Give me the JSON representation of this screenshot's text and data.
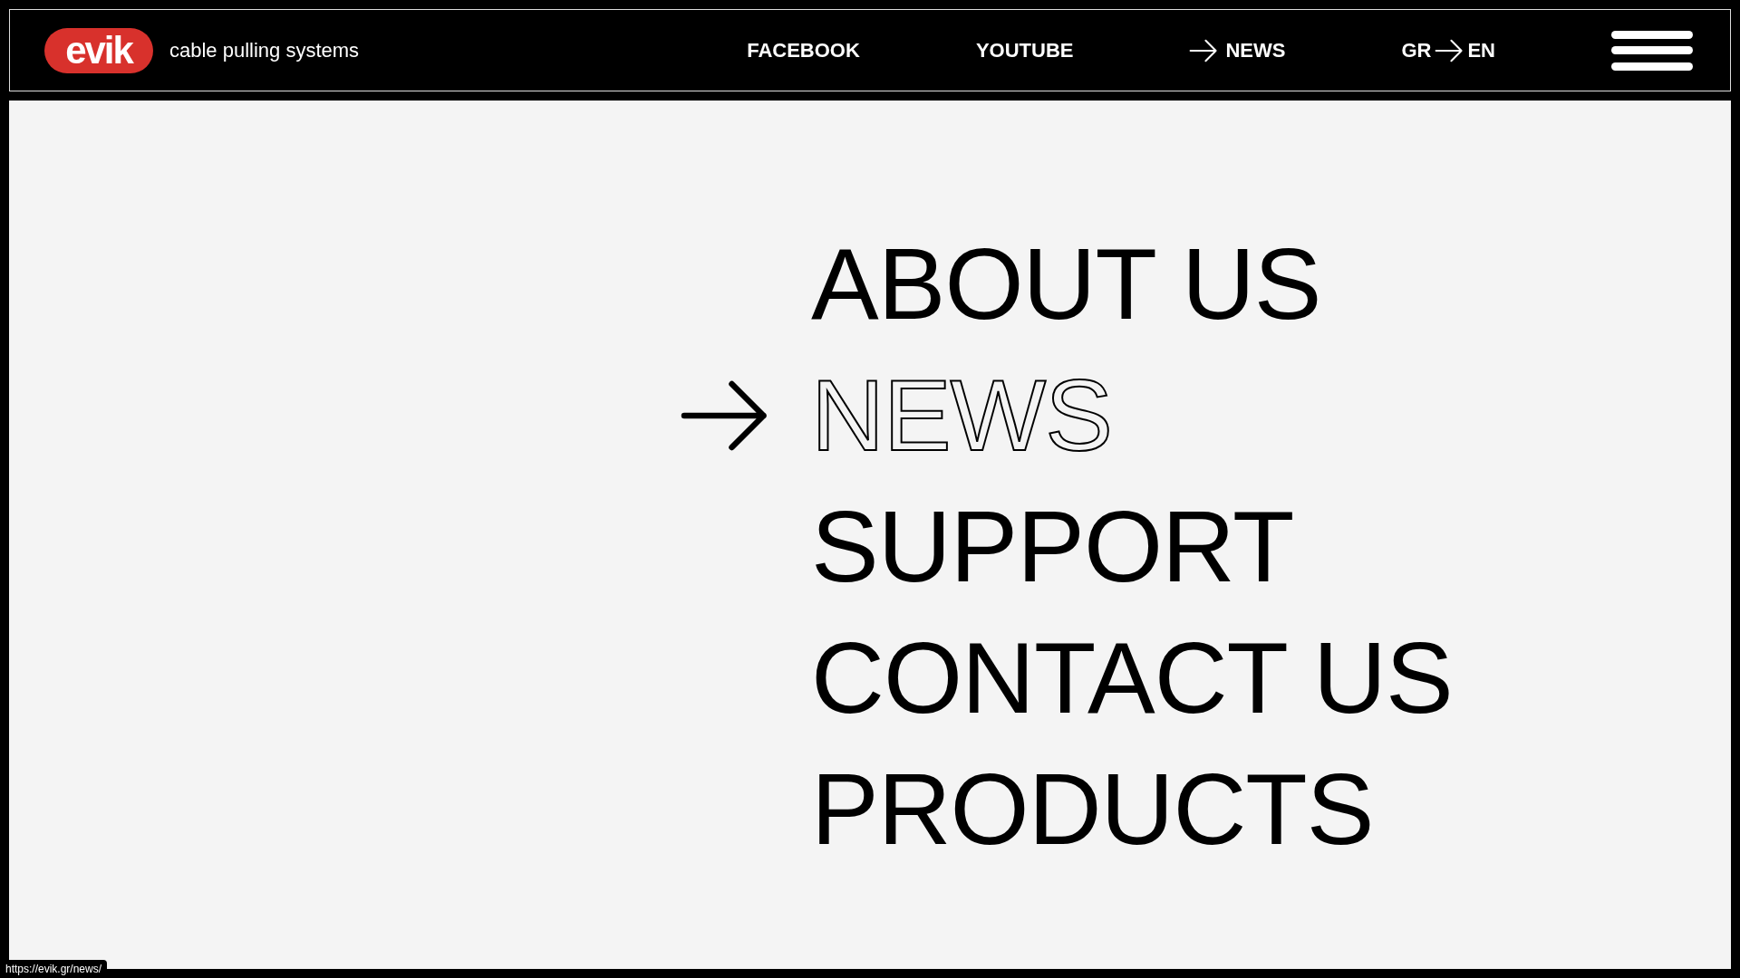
{
  "header": {
    "logo": {
      "text": "evik"
    },
    "tagline": "cable pulling systems",
    "links": [
      {
        "label": "FACEBOOK",
        "selected": false
      },
      {
        "label": "YOUTUBE",
        "selected": false
      },
      {
        "label": "NEWS",
        "selected": true
      }
    ],
    "language": {
      "from": "GR",
      "to": "EN"
    }
  },
  "menu": {
    "items": [
      {
        "label": "ABOUT US",
        "selected": false
      },
      {
        "label": "NEWS",
        "selected": true
      },
      {
        "label": "SUPPORT",
        "selected": false
      },
      {
        "label": "CONTACT US",
        "selected": false
      },
      {
        "label": "PRODUCTS",
        "selected": false
      }
    ]
  },
  "status_bar": {
    "url": "https://evik.gr/news/"
  }
}
